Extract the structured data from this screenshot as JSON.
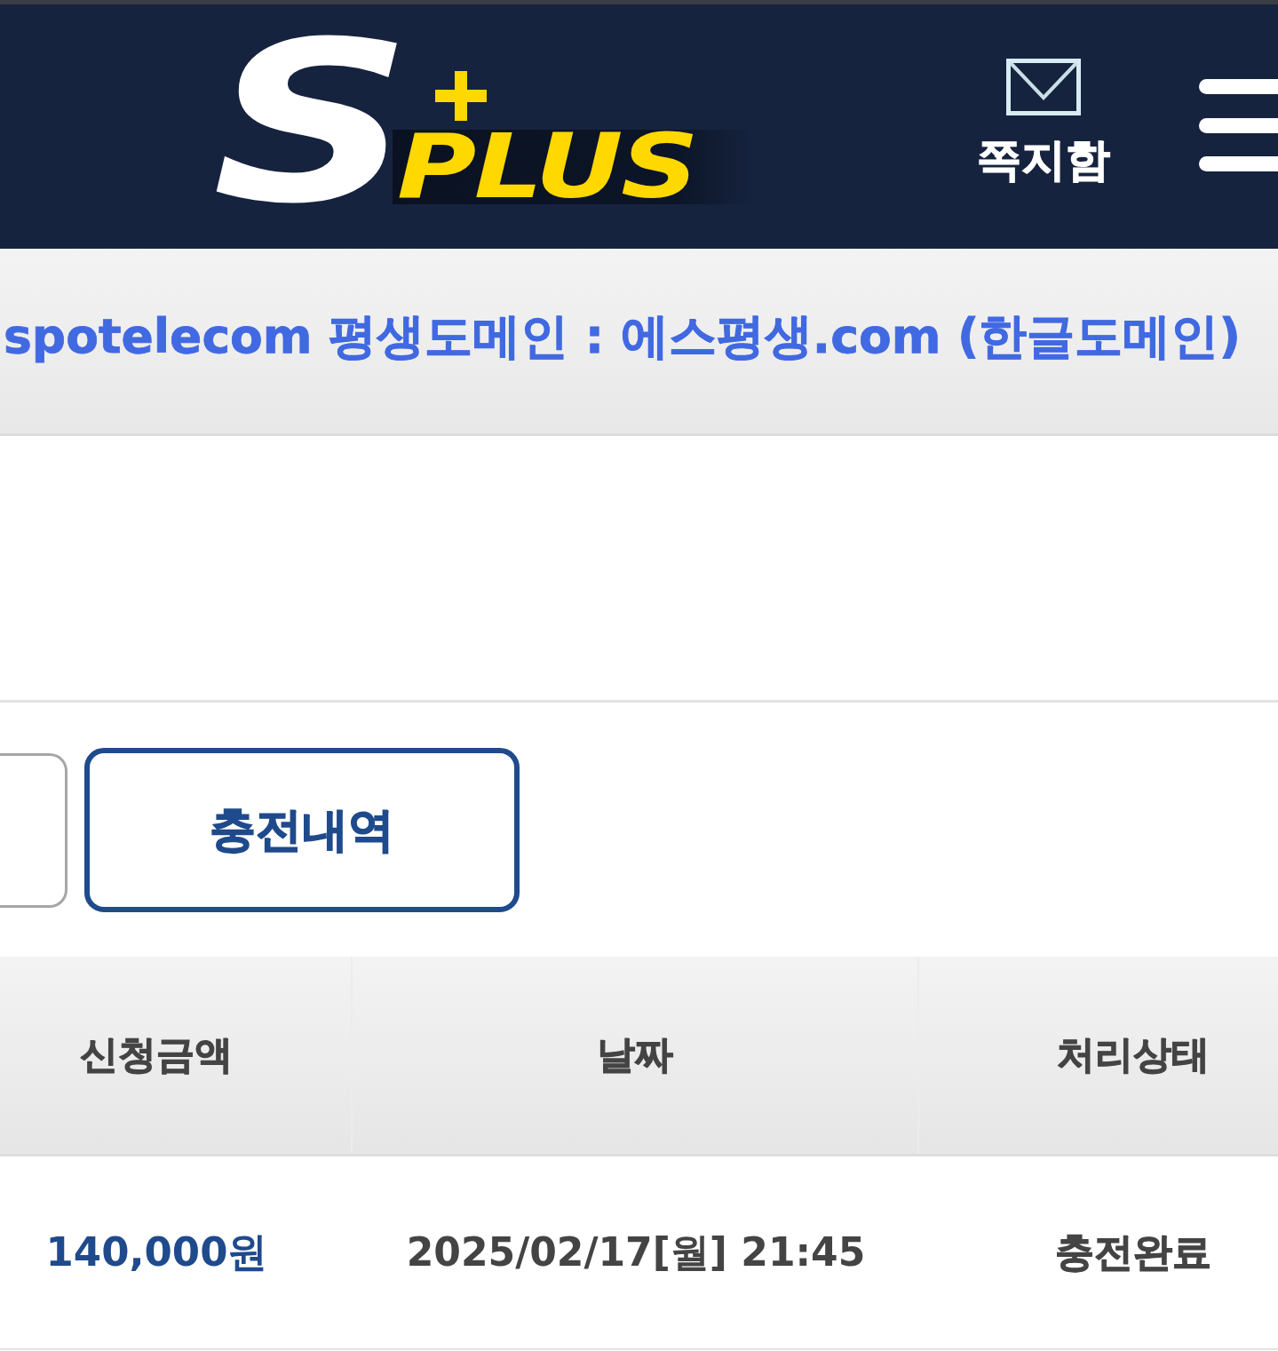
{
  "header": {
    "logo": {
      "letter": "S",
      "wordmark": "PLUS"
    },
    "mailbox": {
      "label": "쪽지함"
    }
  },
  "notice": {
    "text": "spotelecom 평생도메인 : 에스평생.com (한글도메인)"
  },
  "tabs": [
    {
      "selected": false
    },
    {
      "label": "충전내역",
      "selected": true
    }
  ],
  "table": {
    "columns": [
      "신청금액",
      "날짜",
      "처리상태"
    ],
    "rows": [
      {
        "amount": "140,000원",
        "date": "2025/02/17[월] 21:45",
        "status": "충전완료"
      }
    ]
  }
}
